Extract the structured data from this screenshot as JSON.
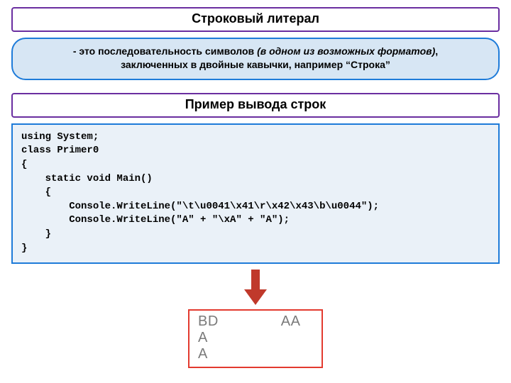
{
  "title1": "Строковый литерал",
  "info_part1": "- это последовательность символов ",
  "info_italic": "(в одном из возможных форматов)",
  "info_part2": ",",
  "info_line2": "заключенных в двойные кавычки, например  “Строка”",
  "title2": "Пример вывода строк",
  "code": "using System;\nclass Primer0\n{\n    static void Main()\n    {\n        Console.WriteLine(\"\\t\\u0041\\x41\\r\\x42\\x43\\b\\u0044\");\n        Console.WriteLine(\"A\" + \"\\xA\" + \"A\");\n    }\n}",
  "output": {
    "r1a": "BD",
    "r1b": "AA",
    "r2": "A",
    "r3": "A"
  },
  "colors": {
    "purple": "#6a2ea0",
    "blue": "#1e7bd9",
    "red": "#e33a2f",
    "arrow": "#c0392b"
  }
}
